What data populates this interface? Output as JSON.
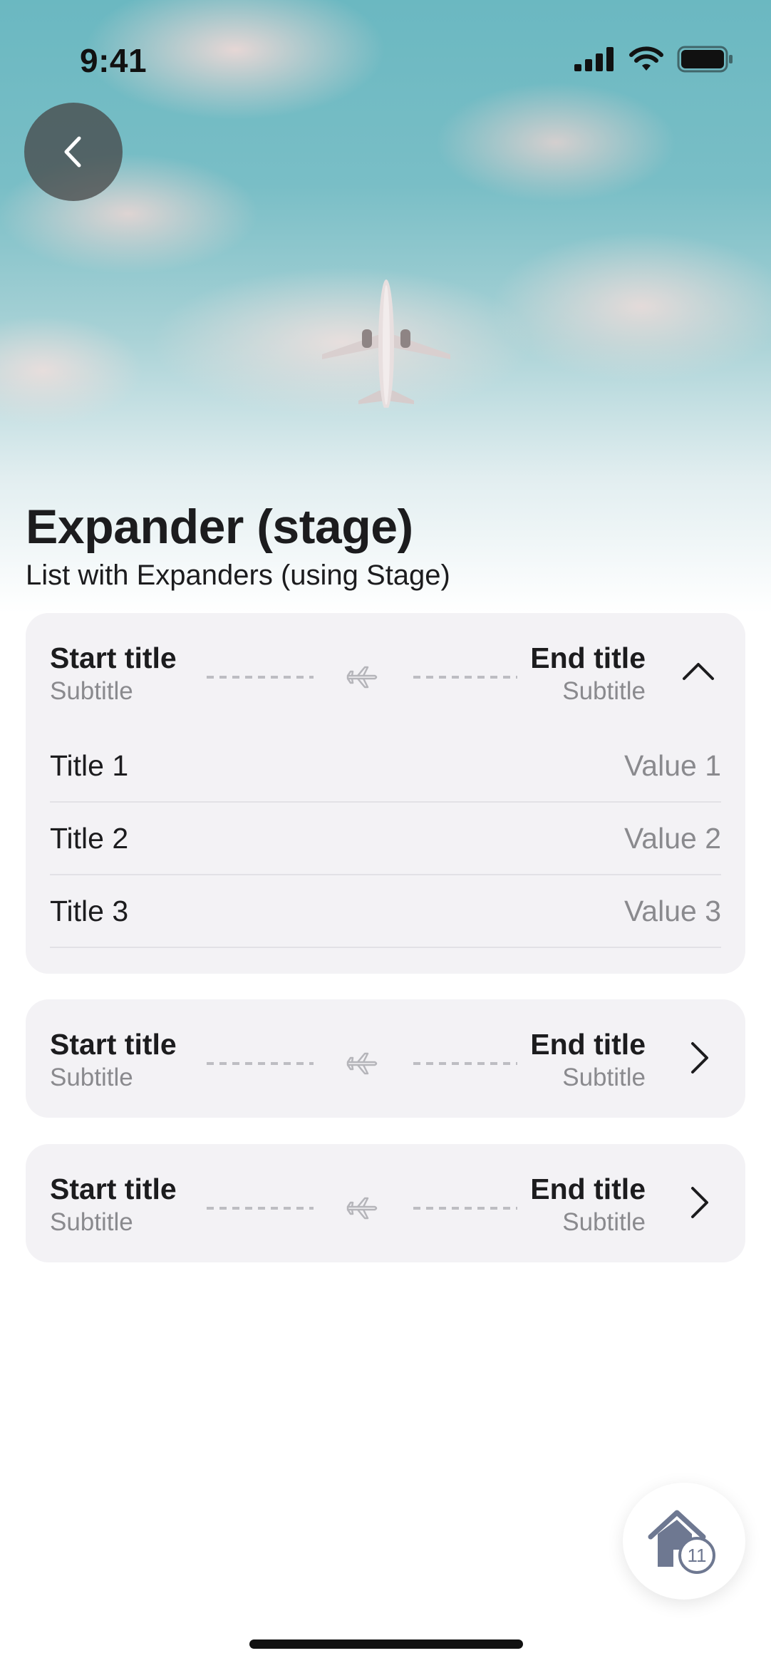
{
  "status_bar": {
    "time": "9:41"
  },
  "header": {
    "title": "Expander (stage)",
    "subtitle": "List with Expanders (using Stage)"
  },
  "expanders": [
    {
      "start_title": "Start title",
      "start_subtitle": "Subtitle",
      "end_title": "End title",
      "end_subtitle": "Subtitle",
      "expanded": true,
      "rows": [
        {
          "title": "Title 1",
          "value": "Value 1"
        },
        {
          "title": "Title 2",
          "value": "Value 2"
        },
        {
          "title": "Title 3",
          "value": "Value 3"
        }
      ]
    },
    {
      "start_title": "Start title",
      "start_subtitle": "Subtitle",
      "end_title": "End title",
      "end_subtitle": "Subtitle",
      "expanded": false
    },
    {
      "start_title": "Start title",
      "start_subtitle": "Subtitle",
      "end_title": "End title",
      "end_subtitle": "Subtitle",
      "expanded": false
    }
  ],
  "home_button": {
    "badge": "11"
  },
  "colors": {
    "card_bg": "#f3f2f5",
    "secondary_text": "#8a8a8e",
    "icon_gray": "#6e7891"
  }
}
